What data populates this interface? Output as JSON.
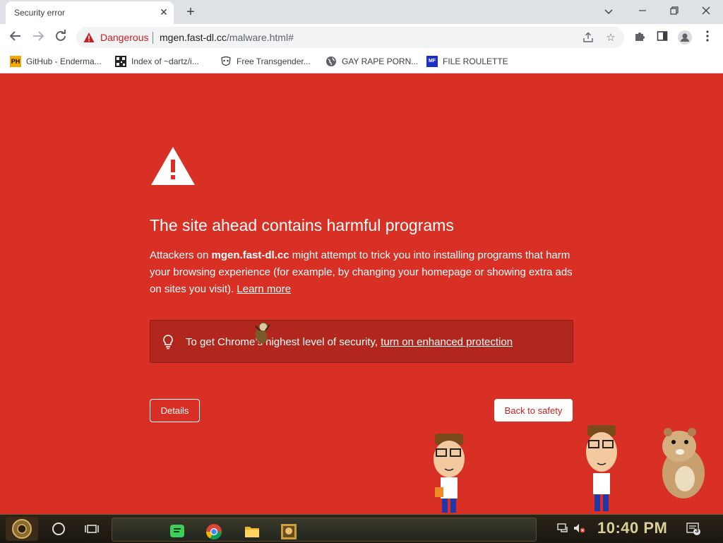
{
  "tab": {
    "title": "Security error"
  },
  "omnibox": {
    "security_label": "Dangerous",
    "host": "mgen.fast-dl.cc",
    "path": "/malware.html#"
  },
  "bookmarks": [
    {
      "label": "GitHub - Enderma...",
      "icon": "ph-favicon"
    },
    {
      "label": "Index of ~dartz/i...",
      "icon": "qr-favicon"
    },
    {
      "label": "Free Transgender...",
      "icon": "mask-favicon"
    },
    {
      "label": "GAY RAPE PORN...",
      "icon": "globe-icon"
    },
    {
      "label": "FILE ROULETTE",
      "icon": "mf-favicon"
    }
  ],
  "interstitial": {
    "heading": "The site ahead contains harmful programs",
    "para_before": "Attackers on ",
    "para_host": "mgen.fast-dl.cc",
    "para_after": " might attempt to trick you into installing programs that harm your browsing experience (for example, by changing your homepage or showing extra ads on sites you visit). ",
    "learn_more": "Learn more",
    "hint_text": "To get Chrome’s highest level of security, ",
    "hint_link": "turn on enhanced protection",
    "details_button": "Details",
    "back_button": "Back to safety"
  },
  "taskbar": {
    "clock": "10:40 PM",
    "notification_count": "3"
  },
  "colors": {
    "danger_bg": "#d93025",
    "hint_bg": "#b1271d",
    "danger_text": "#c5221f"
  }
}
